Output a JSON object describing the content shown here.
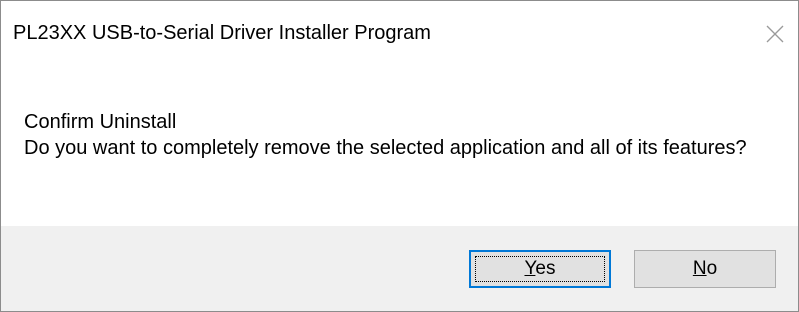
{
  "window": {
    "title": "PL23XX USB-to-Serial Driver Installer Program"
  },
  "titlebar": {
    "close_icon": "close-icon"
  },
  "message": {
    "heading": "Confirm Uninstall",
    "body": "Do you want to completely remove the selected application and all of its features?"
  },
  "buttons": {
    "yes": {
      "mnemonic": "Y",
      "rest": "es"
    },
    "no": {
      "mnemonic": "N",
      "rest": "o"
    }
  },
  "colors": {
    "default_button_border": "#0078d7",
    "footer_background": "#f0f0f0",
    "button_background": "#e1e1e1"
  }
}
